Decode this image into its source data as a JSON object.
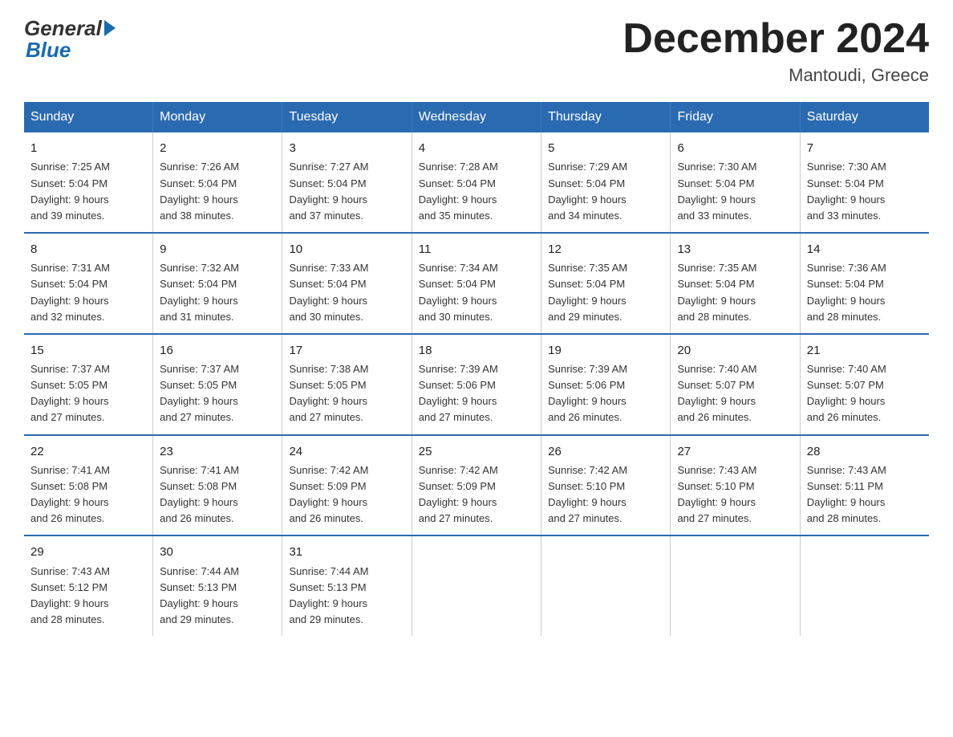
{
  "header": {
    "logo_general": "General",
    "logo_blue": "Blue",
    "month_title": "December 2024",
    "location": "Mantoudi, Greece"
  },
  "days_of_week": [
    "Sunday",
    "Monday",
    "Tuesday",
    "Wednesday",
    "Thursday",
    "Friday",
    "Saturday"
  ],
  "weeks": [
    [
      {
        "day": "1",
        "sunrise": "7:25 AM",
        "sunset": "5:04 PM",
        "daylight": "9 hours and 39 minutes."
      },
      {
        "day": "2",
        "sunrise": "7:26 AM",
        "sunset": "5:04 PM",
        "daylight": "9 hours and 38 minutes."
      },
      {
        "day": "3",
        "sunrise": "7:27 AM",
        "sunset": "5:04 PM",
        "daylight": "9 hours and 37 minutes."
      },
      {
        "day": "4",
        "sunrise": "7:28 AM",
        "sunset": "5:04 PM",
        "daylight": "9 hours and 35 minutes."
      },
      {
        "day": "5",
        "sunrise": "7:29 AM",
        "sunset": "5:04 PM",
        "daylight": "9 hours and 34 minutes."
      },
      {
        "day": "6",
        "sunrise": "7:30 AM",
        "sunset": "5:04 PM",
        "daylight": "9 hours and 33 minutes."
      },
      {
        "day": "7",
        "sunrise": "7:30 AM",
        "sunset": "5:04 PM",
        "daylight": "9 hours and 33 minutes."
      }
    ],
    [
      {
        "day": "8",
        "sunrise": "7:31 AM",
        "sunset": "5:04 PM",
        "daylight": "9 hours and 32 minutes."
      },
      {
        "day": "9",
        "sunrise": "7:32 AM",
        "sunset": "5:04 PM",
        "daylight": "9 hours and 31 minutes."
      },
      {
        "day": "10",
        "sunrise": "7:33 AM",
        "sunset": "5:04 PM",
        "daylight": "9 hours and 30 minutes."
      },
      {
        "day": "11",
        "sunrise": "7:34 AM",
        "sunset": "5:04 PM",
        "daylight": "9 hours and 30 minutes."
      },
      {
        "day": "12",
        "sunrise": "7:35 AM",
        "sunset": "5:04 PM",
        "daylight": "9 hours and 29 minutes."
      },
      {
        "day": "13",
        "sunrise": "7:35 AM",
        "sunset": "5:04 PM",
        "daylight": "9 hours and 28 minutes."
      },
      {
        "day": "14",
        "sunrise": "7:36 AM",
        "sunset": "5:04 PM",
        "daylight": "9 hours and 28 minutes."
      }
    ],
    [
      {
        "day": "15",
        "sunrise": "7:37 AM",
        "sunset": "5:05 PM",
        "daylight": "9 hours and 27 minutes."
      },
      {
        "day": "16",
        "sunrise": "7:37 AM",
        "sunset": "5:05 PM",
        "daylight": "9 hours and 27 minutes."
      },
      {
        "day": "17",
        "sunrise": "7:38 AM",
        "sunset": "5:05 PM",
        "daylight": "9 hours and 27 minutes."
      },
      {
        "day": "18",
        "sunrise": "7:39 AM",
        "sunset": "5:06 PM",
        "daylight": "9 hours and 27 minutes."
      },
      {
        "day": "19",
        "sunrise": "7:39 AM",
        "sunset": "5:06 PM",
        "daylight": "9 hours and 26 minutes."
      },
      {
        "day": "20",
        "sunrise": "7:40 AM",
        "sunset": "5:07 PM",
        "daylight": "9 hours and 26 minutes."
      },
      {
        "day": "21",
        "sunrise": "7:40 AM",
        "sunset": "5:07 PM",
        "daylight": "9 hours and 26 minutes."
      }
    ],
    [
      {
        "day": "22",
        "sunrise": "7:41 AM",
        "sunset": "5:08 PM",
        "daylight": "9 hours and 26 minutes."
      },
      {
        "day": "23",
        "sunrise": "7:41 AM",
        "sunset": "5:08 PM",
        "daylight": "9 hours and 26 minutes."
      },
      {
        "day": "24",
        "sunrise": "7:42 AM",
        "sunset": "5:09 PM",
        "daylight": "9 hours and 26 minutes."
      },
      {
        "day": "25",
        "sunrise": "7:42 AM",
        "sunset": "5:09 PM",
        "daylight": "9 hours and 27 minutes."
      },
      {
        "day": "26",
        "sunrise": "7:42 AM",
        "sunset": "5:10 PM",
        "daylight": "9 hours and 27 minutes."
      },
      {
        "day": "27",
        "sunrise": "7:43 AM",
        "sunset": "5:10 PM",
        "daylight": "9 hours and 27 minutes."
      },
      {
        "day": "28",
        "sunrise": "7:43 AM",
        "sunset": "5:11 PM",
        "daylight": "9 hours and 28 minutes."
      }
    ],
    [
      {
        "day": "29",
        "sunrise": "7:43 AM",
        "sunset": "5:12 PM",
        "daylight": "9 hours and 28 minutes."
      },
      {
        "day": "30",
        "sunrise": "7:44 AM",
        "sunset": "5:13 PM",
        "daylight": "9 hours and 29 minutes."
      },
      {
        "day": "31",
        "sunrise": "7:44 AM",
        "sunset": "5:13 PM",
        "daylight": "9 hours and 29 minutes."
      },
      {
        "day": "",
        "sunrise": "",
        "sunset": "",
        "daylight": ""
      },
      {
        "day": "",
        "sunrise": "",
        "sunset": "",
        "daylight": ""
      },
      {
        "day": "",
        "sunrise": "",
        "sunset": "",
        "daylight": ""
      },
      {
        "day": "",
        "sunrise": "",
        "sunset": "",
        "daylight": ""
      }
    ]
  ],
  "labels": {
    "sunrise_prefix": "Sunrise: ",
    "sunset_prefix": "Sunset: ",
    "daylight_prefix": "Daylight: "
  }
}
